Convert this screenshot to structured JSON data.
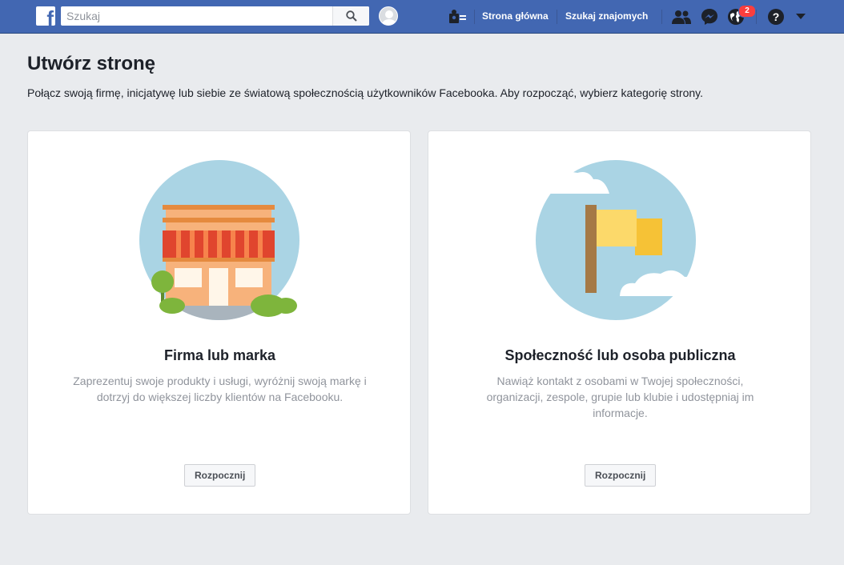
{
  "topbar": {
    "logo_letter": "f",
    "search_placeholder": "Szukaj",
    "home_label": "Strona główna",
    "find_friends_label": "Szukaj znajomych",
    "notifications_count": "2",
    "icons": [
      "search-icon",
      "avatar",
      "create-page-icon",
      "friend-requests-icon",
      "messenger-icon",
      "notifications-icon",
      "help-icon",
      "dropdown-arrow-icon"
    ],
    "colors": {
      "bar": "#4267b2",
      "badge": "#fa3e3e"
    }
  },
  "page": {
    "title": "Utwórz stronę",
    "subtitle": "Połącz swoją firmę, inicjatywę lub siebie ze światową społecznością użytkowników Facebooka. Aby rozpocząć, wybierz kategorię strony."
  },
  "cards": [
    {
      "title": "Firma lub marka",
      "description": "Zaprezentuj swoje produkty i usługi, wyróżnij swoją markę i dotrzyj do większej liczby klientów na Facebooku.",
      "button_label": "Rozpocznij",
      "illustration": "storefront-illustration"
    },
    {
      "title": "Społeczność lub osoba publiczna",
      "description": "Nawiąż kontakt z osobami w Twojej społeczności, organizacji, zespole, grupie lub klubie i udostępniaj im informacje.",
      "button_label": "Rozpocznij",
      "illustration": "flag-illustration"
    }
  ]
}
